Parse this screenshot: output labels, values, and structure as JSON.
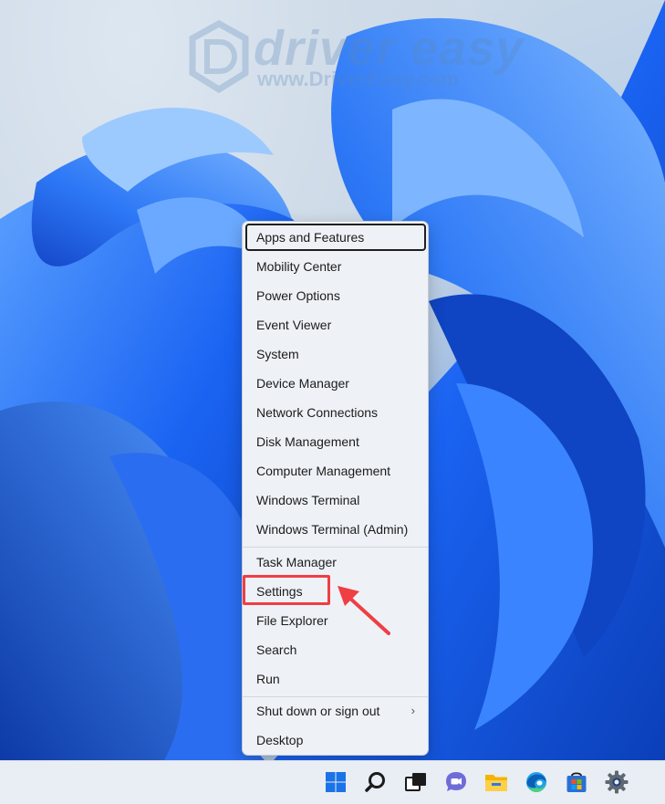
{
  "watermark": {
    "brand": "driver easy",
    "url": "www.DriverEasy.com"
  },
  "menu": {
    "items_group1": [
      "Apps and Features",
      "Mobility Center",
      "Power Options",
      "Event Viewer",
      "System",
      "Device Manager",
      "Network Connections",
      "Disk Management",
      "Computer Management",
      "Windows Terminal",
      "Windows Terminal (Admin)"
    ],
    "items_group2": [
      "Task Manager",
      "Settings",
      "File Explorer",
      "Search",
      "Run"
    ],
    "items_group3": [
      "Shut down or sign out",
      "Desktop"
    ],
    "submenu_chevron": "›"
  },
  "annotation": {
    "highlight_color": "#ef3e44",
    "highlighted_item": "Settings"
  },
  "taskbar": {
    "icons": [
      "windows-start-icon",
      "search-icon",
      "task-view-icon",
      "teams-chat-icon",
      "file-explorer-icon",
      "edge-icon",
      "microsoft-store-icon",
      "settings-gear-icon"
    ]
  }
}
